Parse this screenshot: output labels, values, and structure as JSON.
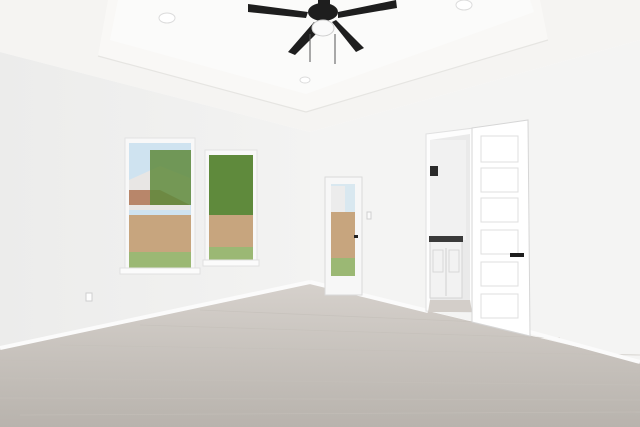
{
  "scene": {
    "type": "photo",
    "subject": "empty-room",
    "colors": {
      "ceiling": "#f5f4f2",
      "tray": "#f9f8f6",
      "wall_left": "#f1f1f0",
      "wall_back": "#f4f4f3",
      "wall_right": "#f6f6f5",
      "floor_light": "#d6d1cc",
      "floor_dark": "#b8b3ad",
      "trim": "#fbfbfb",
      "sky": "#cfe3f0",
      "foliage": "#5f8a3c",
      "fence": "#c7a57e",
      "lawn": "#9bb874",
      "fan": "#1e1e1e",
      "vanity": "#f2f2f2",
      "counter": "#3a3a3a"
    }
  }
}
